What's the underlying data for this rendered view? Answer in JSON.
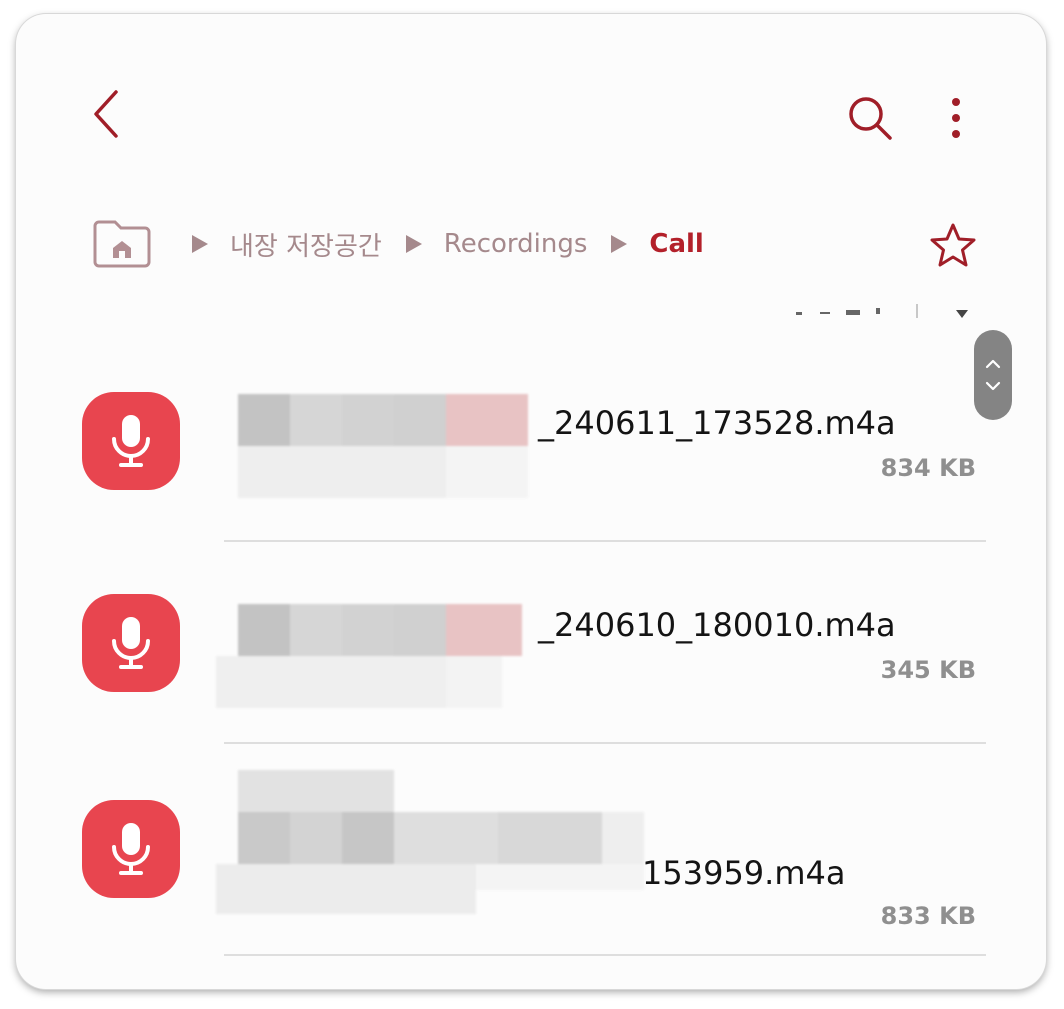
{
  "topbar": {
    "back_icon": "chevron-left-icon",
    "search_icon": "search-icon",
    "more_icon": "more-vertical-icon"
  },
  "breadcrumb": {
    "home_icon": "home-folder-icon",
    "items": [
      {
        "label": "내장 저장공간"
      },
      {
        "label": "Recordings"
      },
      {
        "label": "Call"
      }
    ],
    "favorite_icon": "star-outline-icon"
  },
  "files": [
    {
      "name_suffix": "_240611_173528.m4a",
      "size": "834 KB"
    },
    {
      "name_suffix": "_240610_180010.m4a",
      "size": "345 KB"
    },
    {
      "name_suffix": "153959.m4a",
      "size": "833 KB"
    }
  ],
  "colors": {
    "accent": "#b3202a",
    "icon_red": "#e8454f",
    "muted": "#a5898c"
  }
}
